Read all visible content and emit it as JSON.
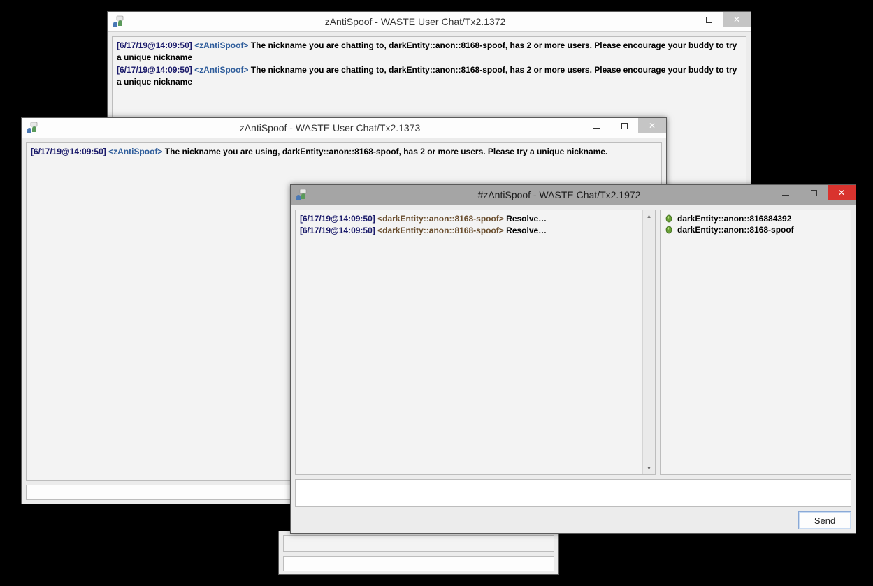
{
  "windows": {
    "w1": {
      "title": "zAntiSpoof - WASTE User Chat/Tx2.1372",
      "messages": [
        {
          "ts": "[6/17/19@14:09:50]",
          "nick": "<zAntiSpoof>",
          "text": "The nickname you are chatting to, darkEntity::anon::8168-spoof, has 2 or more users. Please encourage your buddy to try a unique nickname"
        },
        {
          "ts": "[6/17/19@14:09:50]",
          "nick": "<zAntiSpoof>",
          "text": "The nickname you are chatting to, darkEntity::anon::8168-spoof, has 2 or more users. Please encourage your buddy to try a unique nickname"
        }
      ]
    },
    "w2": {
      "title": "zAntiSpoof - WASTE User Chat/Tx2.1373",
      "messages": [
        {
          "ts": "[6/17/19@14:09:50]",
          "nick": "<zAntiSpoof>",
          "text": "The nickname you are using, darkEntity::anon::8168-spoof, has 2 or more users. Please try a unique nickname."
        }
      ]
    },
    "w3": {
      "title": "#zAntiSpoof - WASTE Chat/Tx2.1972",
      "messages": [
        {
          "ts": "[6/17/19@14:09:50]",
          "nick": "<darkEntity::anon::8168-spoof>",
          "text": "Resolve…"
        },
        {
          "ts": "[6/17/19@14:09:50]",
          "nick": "<darkEntity::anon::8168-spoof>",
          "text": "Resolve…"
        }
      ],
      "users": [
        "darkEntity::anon::816884392",
        "darkEntity::anon::8168-spoof"
      ],
      "send_label": "Send"
    }
  },
  "icons": {
    "app": "chat-users-icon",
    "user": "user-status-icon"
  }
}
